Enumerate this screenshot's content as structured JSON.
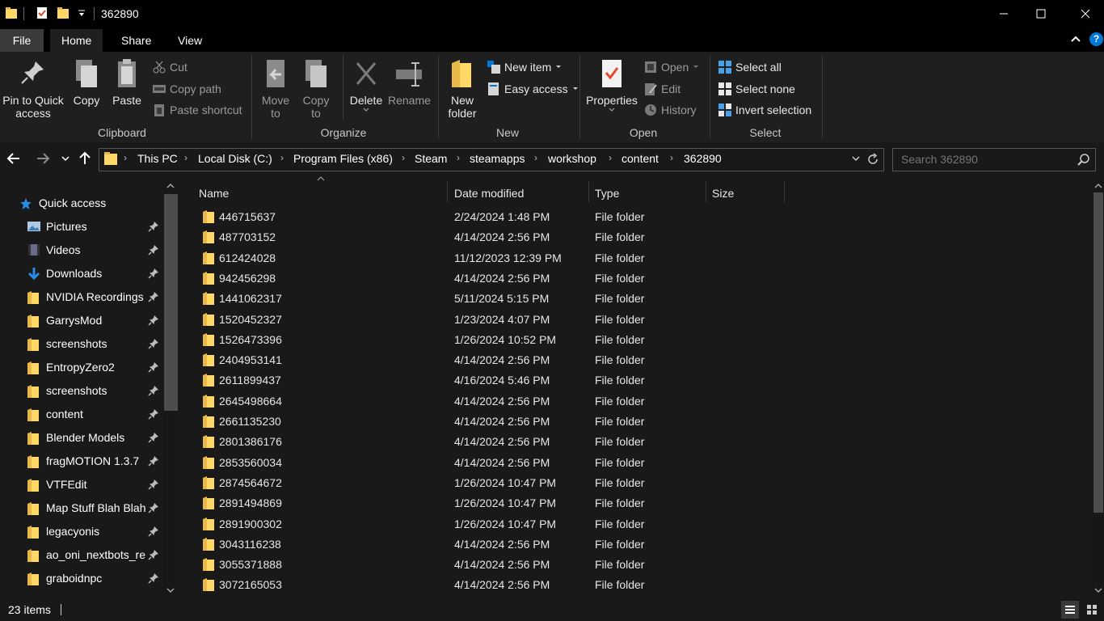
{
  "window": {
    "title": "362890",
    "colors": {
      "background": "#191919",
      "titlebar": "#000000",
      "accent": "#0078d7",
      "folder": "#ffd866"
    }
  },
  "menu": {
    "tabs": [
      "File",
      "Home",
      "Share",
      "View"
    ],
    "active": "Home"
  },
  "ribbon": {
    "clipboard": {
      "label": "Clipboard",
      "pin_line1": "Pin to Quick",
      "pin_line2": "access",
      "copy": "Copy",
      "paste": "Paste",
      "cut": "Cut",
      "copy_path": "Copy path",
      "paste_shortcut": "Paste shortcut"
    },
    "organize": {
      "label": "Organize",
      "move_line1": "Move",
      "move_line2": "to",
      "copy_line1": "Copy",
      "copy_line2": "to",
      "delete": "Delete",
      "rename": "Rename"
    },
    "new": {
      "label": "New",
      "folder_line1": "New",
      "folder_line2": "folder",
      "new_item": "New item",
      "easy_access": "Easy access"
    },
    "open": {
      "label": "Open",
      "properties": "Properties",
      "open": "Open",
      "edit": "Edit",
      "history": "History"
    },
    "select": {
      "label": "Select",
      "select_all": "Select all",
      "select_none": "Select none",
      "invert": "Invert selection"
    }
  },
  "address": {
    "crumbs": [
      "This PC",
      "Local Disk (C:)",
      "Program Files (x86)",
      "Steam",
      "steamapps",
      "workshop",
      "content",
      "362890"
    ]
  },
  "search": {
    "placeholder": "Search 362890"
  },
  "nav": {
    "quick_access": "Quick access",
    "items": [
      {
        "label": "Pictures",
        "icon": "pictures-icon"
      },
      {
        "label": "Videos",
        "icon": "videos-icon"
      },
      {
        "label": "Downloads",
        "icon": "downloads-icon"
      },
      {
        "label": "NVIDIA Recordings",
        "icon": "folder-icon"
      },
      {
        "label": "GarrysMod",
        "icon": "folder-icon"
      },
      {
        "label": "screenshots",
        "icon": "folder-icon"
      },
      {
        "label": "EntropyZero2",
        "icon": "folder-icon"
      },
      {
        "label": "screenshots",
        "icon": "folder-icon"
      },
      {
        "label": "content",
        "icon": "folder-icon"
      },
      {
        "label": "Blender Models",
        "icon": "folder-icon"
      },
      {
        "label": "fragMOTION 1.3.7",
        "icon": "folder-icon"
      },
      {
        "label": "VTFEdit",
        "icon": "folder-icon"
      },
      {
        "label": "Map Stuff Blah Blah",
        "icon": "folder-icon"
      },
      {
        "label": "legacyonis",
        "icon": "folder-icon"
      },
      {
        "label": "ao_oni_nextbots_re",
        "icon": "folder-icon"
      },
      {
        "label": "graboidnpc",
        "icon": "folder-icon"
      }
    ]
  },
  "columns": {
    "name": "Name",
    "date": "Date modified",
    "type": "Type",
    "size": "Size"
  },
  "files": [
    {
      "name": "446715637",
      "date": "2/24/2024 1:48 PM",
      "type": "File folder"
    },
    {
      "name": "487703152",
      "date": "4/14/2024 2:56 PM",
      "type": "File folder"
    },
    {
      "name": "612424028",
      "date": "11/12/2023 12:39 PM",
      "type": "File folder"
    },
    {
      "name": "942456298",
      "date": "4/14/2024 2:56 PM",
      "type": "File folder"
    },
    {
      "name": "1441062317",
      "date": "5/11/2024 5:15 PM",
      "type": "File folder"
    },
    {
      "name": "1520452327",
      "date": "1/23/2024 4:07 PM",
      "type": "File folder"
    },
    {
      "name": "1526473396",
      "date": "1/26/2024 10:52 PM",
      "type": "File folder"
    },
    {
      "name": "2404953141",
      "date": "4/14/2024 2:56 PM",
      "type": "File folder"
    },
    {
      "name": "2611899437",
      "date": "4/16/2024 5:46 PM",
      "type": "File folder"
    },
    {
      "name": "2645498664",
      "date": "4/14/2024 2:56 PM",
      "type": "File folder"
    },
    {
      "name": "2661135230",
      "date": "4/14/2024 2:56 PM",
      "type": "File folder"
    },
    {
      "name": "2801386176",
      "date": "4/14/2024 2:56 PM",
      "type": "File folder"
    },
    {
      "name": "2853560034",
      "date": "4/14/2024 2:56 PM",
      "type": "File folder"
    },
    {
      "name": "2874564672",
      "date": "1/26/2024 10:47 PM",
      "type": "File folder"
    },
    {
      "name": "2891494869",
      "date": "1/26/2024 10:47 PM",
      "type": "File folder"
    },
    {
      "name": "2891900302",
      "date": "1/26/2024 10:47 PM",
      "type": "File folder"
    },
    {
      "name": "3043116238",
      "date": "4/14/2024 2:56 PM",
      "type": "File folder"
    },
    {
      "name": "3055371888",
      "date": "4/14/2024 2:56 PM",
      "type": "File folder"
    },
    {
      "name": "3072165053",
      "date": "4/14/2024 2:56 PM",
      "type": "File folder"
    }
  ],
  "status": {
    "items": "23 items"
  }
}
